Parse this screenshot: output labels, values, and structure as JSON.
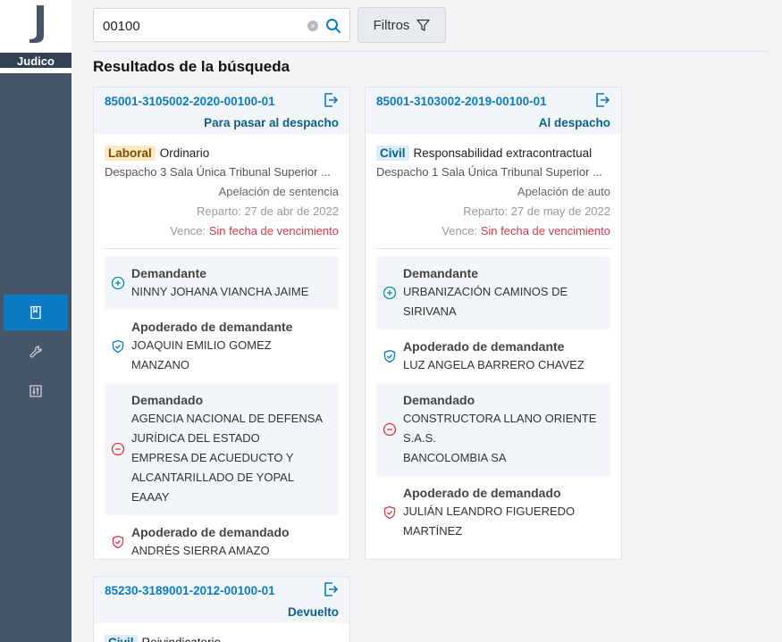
{
  "app": {
    "name": "Judico"
  },
  "search": {
    "value": "00100",
    "clear_symbol": "×"
  },
  "filters": {
    "label": "Filtros"
  },
  "results": {
    "title": "Resultados de la búsqueda"
  },
  "cards": [
    {
      "id": "85001-3105002-2020-00100-01",
      "status": "Para pasar al despacho",
      "category": "Laboral",
      "type": "Ordinario",
      "office": "Despacho 3 Sala Única Tribunal Superior ...",
      "action": "Apelación de sentencia",
      "reparto": "Reparto: 27 de abr de 2022",
      "vence_label": "Vence:",
      "vence_value": "Sin fecha de vencimiento",
      "parties": [
        {
          "role": "Demandante",
          "names": [
            "NINNY JOHANA VIANCHA JAIME"
          ]
        },
        {
          "role": "Apoderado de demandante",
          "names": [
            "JOAQUIN EMILIO GOMEZ",
            "MANZANO"
          ]
        },
        {
          "role": "Demandado",
          "names": [
            "AGENCIA NACIONAL DE DEFENSA",
            "JURÍDICA DEL ESTADO",
            "EMPRESA DE ACUEDUCTO Y",
            "ALCANTARILLADO DE YOPAL EAAAY"
          ]
        },
        {
          "role": "Apoderado de demandado",
          "names": [
            "ANDRÉS SIERRA AMAZO"
          ]
        }
      ]
    },
    {
      "id": "85001-3103002-2019-00100-01",
      "status": "Al despacho",
      "category": "Civil",
      "type": "Responsabilidad extracontractual",
      "office": "Despacho 1 Sala Única Tribunal Superior ...",
      "action": "Apelación de auto",
      "reparto": "Reparto: 27 de may de 2022",
      "vence_label": "Vence:",
      "vence_value": "Sin fecha de vencimiento",
      "parties": [
        {
          "role": "Demandante",
          "names": [
            "URBANIZACIÓN CAMINOS DE",
            "SIRIVANA"
          ]
        },
        {
          "role": "Apoderado de demandante",
          "names": [
            "LUZ ANGELA BARRERO CHAVEZ"
          ]
        },
        {
          "role": "Demandado",
          "names": [
            "CONSTRUCTORA LLANO ORIENTE",
            "S.A.S.",
            "BANCOLOMBIA SA"
          ]
        },
        {
          "role": "Apoderado de demandado",
          "names": [
            "JULIÁN LEANDRO FIGUEREDO",
            "MARTÍNEZ"
          ]
        }
      ]
    },
    {
      "id": "85230-3189001-2012-00100-01",
      "status": "Devuelto",
      "category": "Civil",
      "type": "Reivindicatorio"
    }
  ],
  "colors": {
    "accent": "#0b7bc4",
    "sidebar": "#475569",
    "danger": "#d93b4b",
    "success": "#0b8fa0"
  }
}
